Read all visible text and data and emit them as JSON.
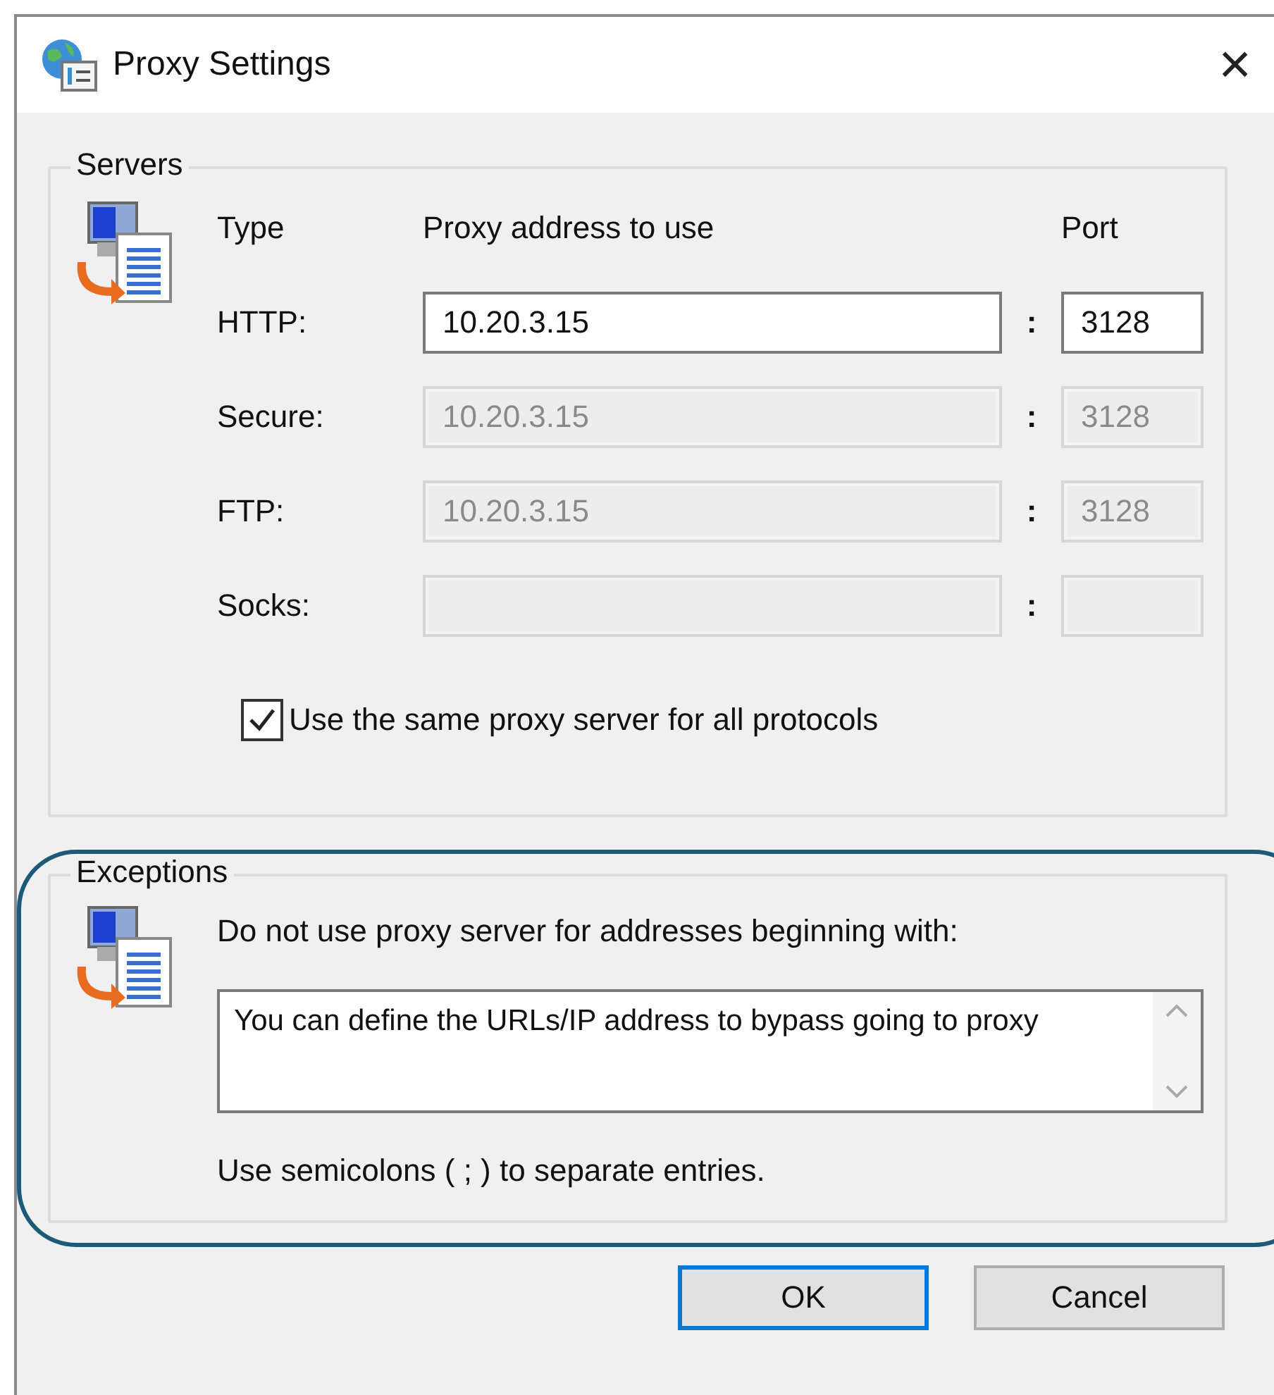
{
  "window": {
    "title": "Proxy Settings",
    "close": "×"
  },
  "servers": {
    "legend": "Servers",
    "headers": {
      "type": "Type",
      "address": "Proxy address to use",
      "port": "Port"
    },
    "rows": [
      {
        "label": "HTTP:",
        "address": "10.20.3.15",
        "port": "3128",
        "disabled": false
      },
      {
        "label": "Secure:",
        "address": "10.20.3.15",
        "port": "3128",
        "disabled": true
      },
      {
        "label": "FTP:",
        "address": "10.20.3.15",
        "port": "3128",
        "disabled": true
      },
      {
        "label": "Socks:",
        "disabled": true
      }
    ],
    "separator": ":",
    "same_proxy": {
      "label": "Use the same proxy server for all protocols",
      "checked": true
    }
  },
  "exceptions": {
    "legend": "Exceptions",
    "instruction": "Do not use proxy server for addresses beginning with:",
    "value": "You can define the URLs/IP address to bypass going to proxy",
    "note": "Use semicolons ( ; ) to separate entries."
  },
  "buttons": [
    {
      "label": "OK",
      "default": true
    },
    {
      "label": "Cancel",
      "default": false
    }
  ]
}
